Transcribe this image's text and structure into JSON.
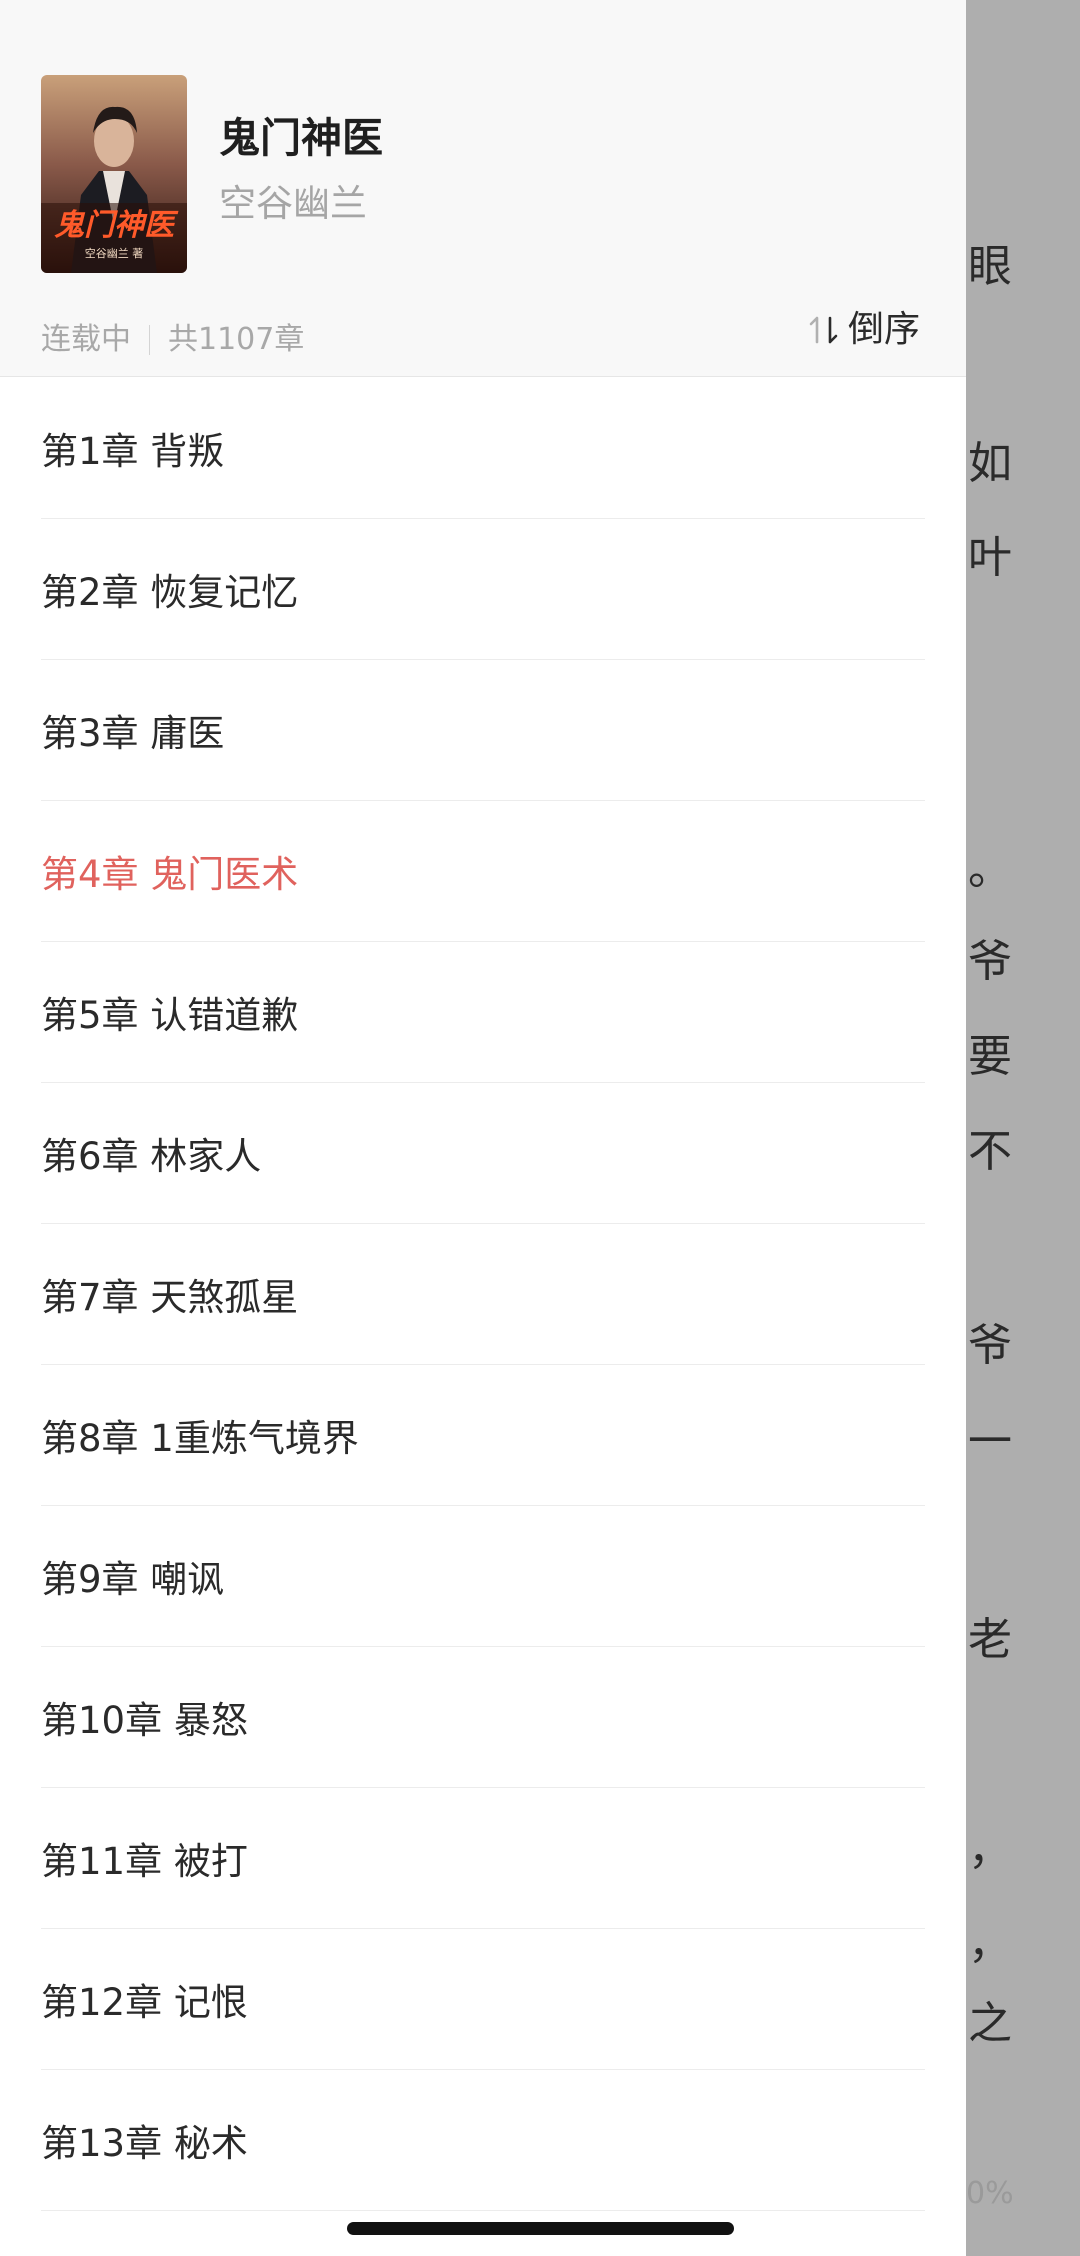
{
  "book": {
    "title": "鬼门神医",
    "author": "空谷幽兰",
    "status": "连载中",
    "chapter_count": "共1107章",
    "cover_title": "鬼门神医",
    "cover_author": "空谷幽兰 著"
  },
  "sort": {
    "label": "倒序",
    "icon": "sort-arrows-icon"
  },
  "chapters": [
    {
      "label": "第1章 背叛"
    },
    {
      "label": "第2章 恢复记忆"
    },
    {
      "label": "第3章 庸医"
    },
    {
      "label": "第4章 鬼门医术",
      "active": true
    },
    {
      "label": "第5章 认错道歉"
    },
    {
      "label": "第6章 林家人"
    },
    {
      "label": "第7章 天煞孤星"
    },
    {
      "label": "第8章 1重炼气境界"
    },
    {
      "label": "第9章 嘲讽"
    },
    {
      "label": "第10章 暴怒"
    },
    {
      "label": "第11章 被打"
    },
    {
      "label": "第12章 记恨"
    },
    {
      "label": "第13章 秘术"
    }
  ],
  "reader_background": {
    "chars": [
      "眼",
      "如",
      "叶",
      "。",
      "爷",
      "要",
      "不",
      "爷",
      "一",
      "老",
      "，",
      "，",
      "之"
    ],
    "progress": "0%"
  },
  "colors": {
    "active_chapter": "#e0625d",
    "drawer_bg": "#ffffff",
    "header_bg": "#f8f8f8",
    "overlay": "#aeaeae"
  }
}
